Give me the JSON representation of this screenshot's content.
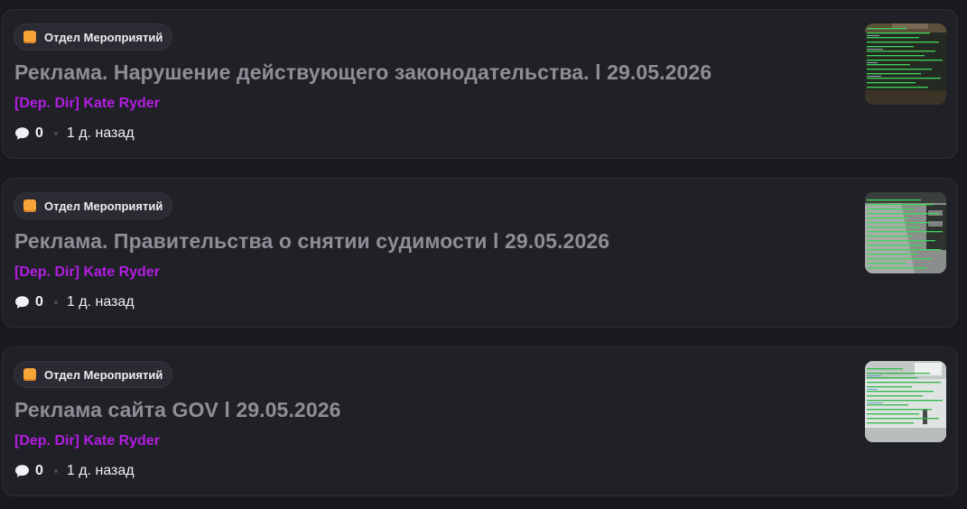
{
  "posts": [
    {
      "category": "Отдел Мероприятий",
      "title": "Реклама. Нарушение действующего законодательства. l 29.05.2026",
      "author": "[Dep. Dir] Kate Ryder",
      "comments": "0",
      "time": "1 д. назад",
      "thumbnail_icon": "chat-log-screenshot-dark"
    },
    {
      "category": "Отдел Мероприятий",
      "title": "Реклама. Правительства о снятии судимости l 29.05.2026",
      "author": "[Dep. Dir] Kate Ryder",
      "comments": "0",
      "time": "1 д. назад",
      "thumbnail_icon": "chat-log-screenshot-grey"
    },
    {
      "category": "Отдел Мероприятий",
      "title": "Реклама сайта GOV l 29.05.2026",
      "author": "[Dep. Dir] Kate Ryder",
      "comments": "0",
      "time": "1 д. назад",
      "thumbnail_icon": "chat-log-screenshot-light"
    }
  ],
  "colors": {
    "background": "#19191f",
    "card": "#202027",
    "title": "#8e8e96",
    "author": "#b21ee0",
    "category_icon": "#f7a335",
    "chat_text_green": "#3fd65a"
  }
}
